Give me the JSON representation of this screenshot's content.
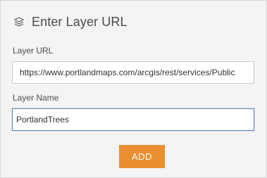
{
  "panel": {
    "title": "Enter Layer URL",
    "title_icon": "layers-icon"
  },
  "form": {
    "url_label": "Layer URL",
    "url_value": "https://www.portlandmaps.com/arcgis/rest/services/Public",
    "name_label": "Layer Name",
    "name_value": "PortlandTrees",
    "add_label": "ADD"
  },
  "colors": {
    "panel_bg": "#f4f4f4",
    "accent_button": "#ea8e32",
    "focus_border": "#5a84b4"
  }
}
